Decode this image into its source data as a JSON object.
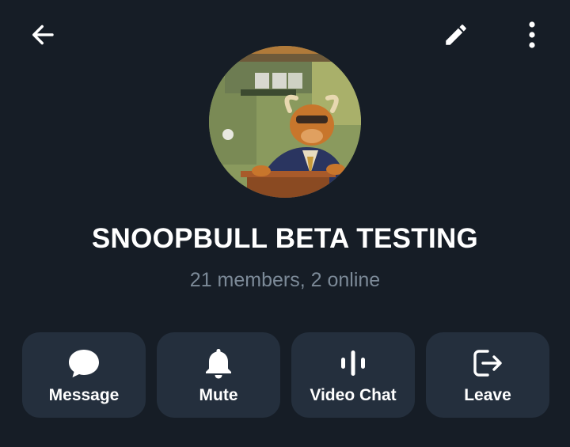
{
  "header": {
    "back_icon": "arrow-left-icon",
    "edit_icon": "pencil-icon",
    "more_icon": "more-vertical-icon"
  },
  "profile": {
    "avatar_description": "group-avatar",
    "name": "SNOOPBULL BETA TESTING",
    "status": "21 members, 2 online"
  },
  "actions": [
    {
      "label": "Message",
      "icon": "chat-bubble-icon"
    },
    {
      "label": "Mute",
      "icon": "bell-icon"
    },
    {
      "label": "Video Chat",
      "icon": "voice-chat-icon"
    },
    {
      "label": "Leave",
      "icon": "leave-icon"
    }
  ],
  "colors": {
    "background": "#161d26",
    "button_bg": "#242f3d",
    "secondary_text": "#7c8a98",
    "primary_text": "#ffffff"
  }
}
